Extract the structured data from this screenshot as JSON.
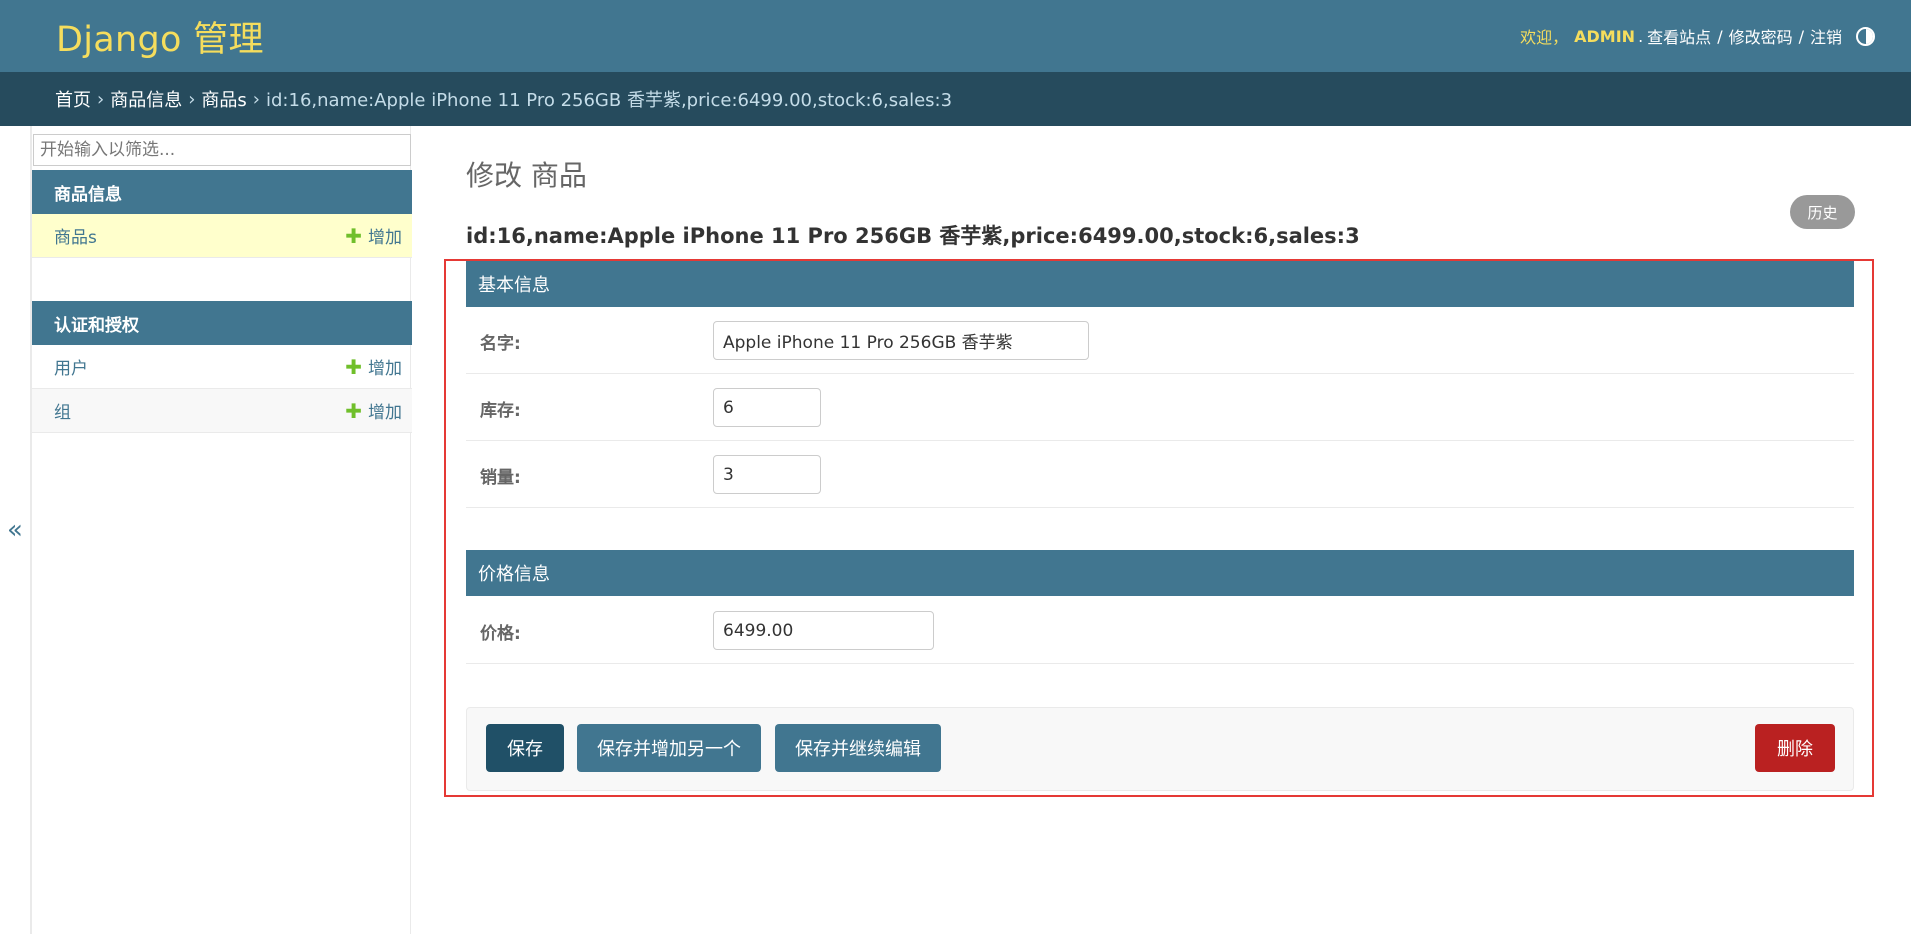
{
  "header": {
    "site_name": "Django 管理",
    "welcome": "欢迎，",
    "username": "ADMIN",
    "period": ".",
    "view_site": "查看站点",
    "change_password": "修改密码",
    "logout": "注销",
    "separator": "/"
  },
  "breadcrumbs": {
    "home": "首页",
    "app": "商品信息",
    "model": "商品s",
    "current": "id:16,name:Apple iPhone 11 Pro 256GB 香芋紫,price:6499.00,stock:6,sales:3",
    "arrow": "›"
  },
  "sidebar": {
    "filter_placeholder": "开始输入以筛选...",
    "toggle_label": "«",
    "apps": [
      {
        "caption": "商品信息",
        "models": [
          {
            "label": "商品s",
            "add_label": "增加",
            "current": true
          }
        ]
      },
      {
        "caption": "认证和授权",
        "models": [
          {
            "label": "用户",
            "add_label": "增加",
            "current": false
          },
          {
            "label": "组",
            "add_label": "增加",
            "current": false
          }
        ]
      }
    ],
    "plus_glyph": "✚"
  },
  "content": {
    "title": "修改 商品",
    "history_label": "历史",
    "object_title": "id:16,name:Apple iPhone 11 Pro 256GB 香芋紫,price:6499.00,stock:6,sales:3",
    "fieldsets": [
      {
        "caption": "基本信息",
        "fields": [
          {
            "label": "名字:",
            "value": "Apple iPhone 11 Pro 256GB 香芋紫"
          },
          {
            "label": "库存:",
            "value": "6"
          },
          {
            "label": "销量:",
            "value": "3"
          }
        ]
      },
      {
        "caption": "价格信息",
        "fields": [
          {
            "label": "价格:",
            "value": "6499.00"
          }
        ]
      }
    ],
    "buttons": {
      "save": "保存",
      "save_add_another": "保存并增加另一个",
      "save_continue": "保存并继续编辑",
      "delete": "删除"
    }
  },
  "colors": {
    "header_bg": "#417690",
    "breadcrumb_bg": "#264b5d",
    "accent_yellow": "#f5dd5d",
    "delete_red": "#ba2121",
    "highlight_box": "#e53935",
    "add_plus_green": "#70bf2b"
  }
}
